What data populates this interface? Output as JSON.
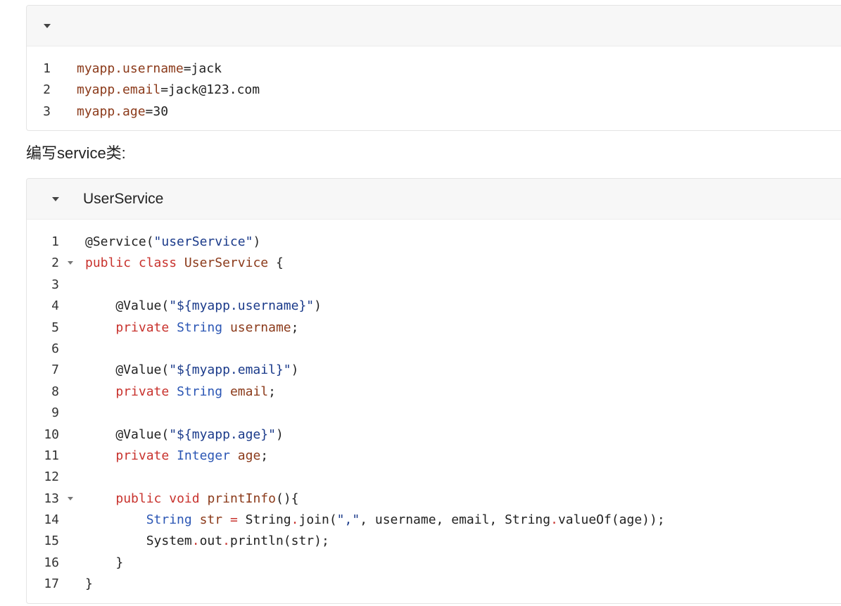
{
  "colors": {
    "keyword": "#c8322d",
    "property": "#8b3a1a",
    "string": "#1a3a8a",
    "type": "#2b56b4",
    "plain": "#222222"
  },
  "icons": {
    "collapse": "triangle-down-icon",
    "fold": "fold-arrow-icon"
  },
  "section_heading": "编写service类:",
  "properties_block": {
    "title": "",
    "lines": [
      {
        "number": "1",
        "tokens": [
          {
            "t": "myapp.username",
            "c": "property"
          },
          {
            "t": "=jack",
            "c": "plain"
          }
        ]
      },
      {
        "number": "2",
        "tokens": [
          {
            "t": "myapp.email",
            "c": "property"
          },
          {
            "t": "=jack@123.com",
            "c": "plain"
          }
        ]
      },
      {
        "number": "3",
        "tokens": [
          {
            "t": "myapp.age",
            "c": "property"
          },
          {
            "t": "=30",
            "c": "plain"
          }
        ]
      }
    ]
  },
  "service_block": {
    "title": "UserService",
    "lines": [
      {
        "number": "1",
        "fold": false,
        "tokens": [
          {
            "t": "@Service(",
            "c": "plain"
          },
          {
            "t": "\"userService\"",
            "c": "string"
          },
          {
            "t": ")",
            "c": "plain"
          }
        ]
      },
      {
        "number": "2",
        "fold": true,
        "tokens": [
          {
            "t": "public",
            "c": "keyword"
          },
          {
            "t": " ",
            "c": "plain"
          },
          {
            "t": "class",
            "c": "keyword"
          },
          {
            "t": " ",
            "c": "plain"
          },
          {
            "t": "UserService",
            "c": "property"
          },
          {
            "t": " {",
            "c": "plain"
          }
        ]
      },
      {
        "number": "3",
        "fold": false,
        "tokens": []
      },
      {
        "number": "4",
        "fold": false,
        "tokens": [
          {
            "t": "    @Value(",
            "c": "plain"
          },
          {
            "t": "\"${myapp.username}\"",
            "c": "string"
          },
          {
            "t": ")",
            "c": "plain"
          }
        ]
      },
      {
        "number": "5",
        "fold": false,
        "tokens": [
          {
            "t": "    ",
            "c": "plain"
          },
          {
            "t": "private",
            "c": "keyword"
          },
          {
            "t": " ",
            "c": "plain"
          },
          {
            "t": "String",
            "c": "type"
          },
          {
            "t": " ",
            "c": "plain"
          },
          {
            "t": "username",
            "c": "property"
          },
          {
            "t": ";",
            "c": "plain"
          }
        ]
      },
      {
        "number": "6",
        "fold": false,
        "tokens": []
      },
      {
        "number": "7",
        "fold": false,
        "tokens": [
          {
            "t": "    @Value(",
            "c": "plain"
          },
          {
            "t": "\"${myapp.email}\"",
            "c": "string"
          },
          {
            "t": ")",
            "c": "plain"
          }
        ]
      },
      {
        "number": "8",
        "fold": false,
        "tokens": [
          {
            "t": "    ",
            "c": "plain"
          },
          {
            "t": "private",
            "c": "keyword"
          },
          {
            "t": " ",
            "c": "plain"
          },
          {
            "t": "String",
            "c": "type"
          },
          {
            "t": " ",
            "c": "plain"
          },
          {
            "t": "email",
            "c": "property"
          },
          {
            "t": ";",
            "c": "plain"
          }
        ]
      },
      {
        "number": "9",
        "fold": false,
        "tokens": []
      },
      {
        "number": "10",
        "fold": false,
        "tokens": [
          {
            "t": "    @Value(",
            "c": "plain"
          },
          {
            "t": "\"${myapp.age}\"",
            "c": "string"
          },
          {
            "t": ")",
            "c": "plain"
          }
        ]
      },
      {
        "number": "11",
        "fold": false,
        "tokens": [
          {
            "t": "    ",
            "c": "plain"
          },
          {
            "t": "private",
            "c": "keyword"
          },
          {
            "t": " ",
            "c": "plain"
          },
          {
            "t": "Integer",
            "c": "type"
          },
          {
            "t": " ",
            "c": "plain"
          },
          {
            "t": "age",
            "c": "property"
          },
          {
            "t": ";",
            "c": "plain"
          }
        ]
      },
      {
        "number": "12",
        "fold": false,
        "tokens": []
      },
      {
        "number": "13",
        "fold": true,
        "tokens": [
          {
            "t": "    ",
            "c": "plain"
          },
          {
            "t": "public",
            "c": "keyword"
          },
          {
            "t": " ",
            "c": "plain"
          },
          {
            "t": "void",
            "c": "keyword"
          },
          {
            "t": " ",
            "c": "plain"
          },
          {
            "t": "printInfo",
            "c": "property"
          },
          {
            "t": "(){",
            "c": "plain"
          }
        ]
      },
      {
        "number": "14",
        "fold": false,
        "tokens": [
          {
            "t": "        ",
            "c": "plain"
          },
          {
            "t": "String",
            "c": "type"
          },
          {
            "t": " ",
            "c": "plain"
          },
          {
            "t": "str",
            "c": "property"
          },
          {
            "t": " ",
            "c": "plain"
          },
          {
            "t": "=",
            "c": "keyword"
          },
          {
            "t": " String",
            "c": "plain"
          },
          {
            "t": ".",
            "c": "keyword"
          },
          {
            "t": "join(",
            "c": "plain"
          },
          {
            "t": "\",\"",
            "c": "string"
          },
          {
            "t": ", username, email, String",
            "c": "plain"
          },
          {
            "t": ".",
            "c": "keyword"
          },
          {
            "t": "valueOf(age));",
            "c": "plain"
          }
        ]
      },
      {
        "number": "15",
        "fold": false,
        "tokens": [
          {
            "t": "        System",
            "c": "plain"
          },
          {
            "t": ".",
            "c": "keyword"
          },
          {
            "t": "out",
            "c": "plain"
          },
          {
            "t": ".",
            "c": "keyword"
          },
          {
            "t": "println(str);",
            "c": "plain"
          }
        ]
      },
      {
        "number": "16",
        "fold": false,
        "tokens": [
          {
            "t": "    }",
            "c": "plain"
          }
        ]
      },
      {
        "number": "17",
        "fold": false,
        "tokens": [
          {
            "t": "}",
            "c": "plain"
          }
        ]
      }
    ]
  }
}
